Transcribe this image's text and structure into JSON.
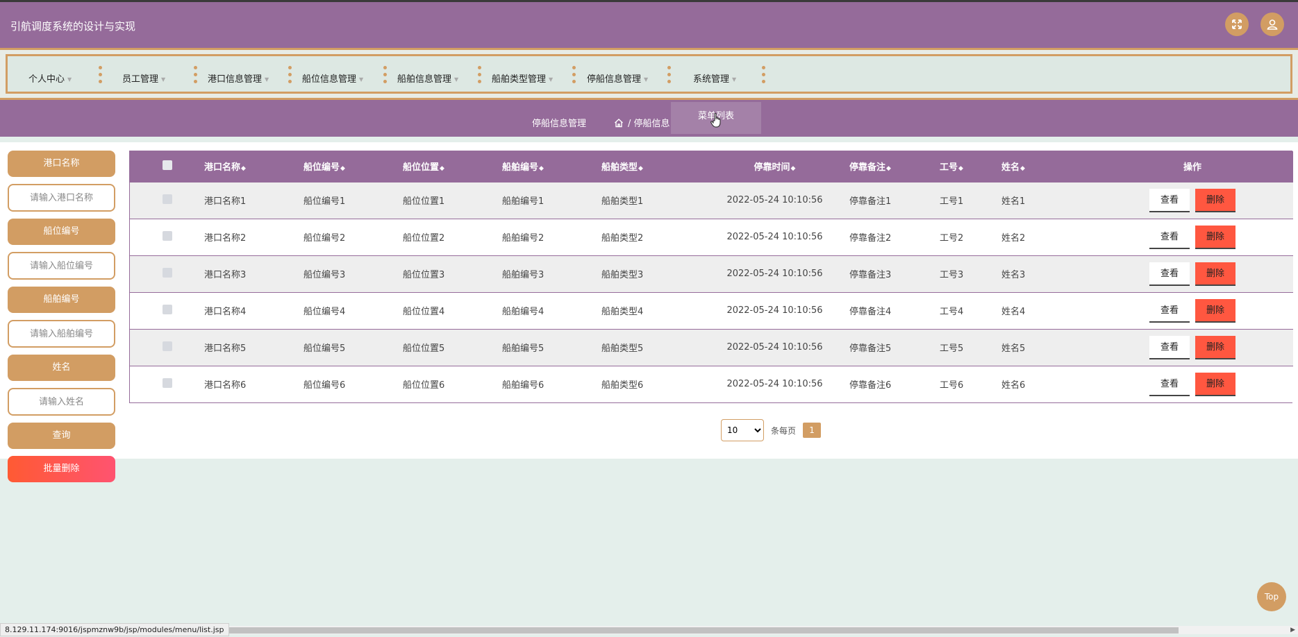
{
  "header": {
    "app_title": "引航调度系统的设计与实现",
    "fullscreen_icon": "expand-icon",
    "user_icon": "user-icon"
  },
  "nav": {
    "items": [
      {
        "label": "个人中心"
      },
      {
        "label": "员工管理"
      },
      {
        "label": "港口信息管理"
      },
      {
        "label": "船位信息管理"
      },
      {
        "label": "船舶信息管理"
      },
      {
        "label": "船舶类型管理"
      },
      {
        "label": "停船信息管理"
      },
      {
        "label": "系统管理"
      }
    ]
  },
  "breadcrumb": {
    "title": "停船信息管理",
    "path_visible": "/ 停船信息",
    "path_tail": "表",
    "tooltip": "菜单列表"
  },
  "sidebar": {
    "fields": [
      {
        "label": "港口名称",
        "placeholder": "请输入港口名称"
      },
      {
        "label": "船位编号",
        "placeholder": "请输入船位编号"
      },
      {
        "label": "船舶编号",
        "placeholder": "请输入船舶编号"
      },
      {
        "label": "姓名",
        "placeholder": "请输入姓名"
      }
    ],
    "query_label": "查询",
    "batch_delete_label": "批量删除"
  },
  "table": {
    "headers": [
      "港口名称",
      "船位编号",
      "船位位置",
      "船舶编号",
      "船舶类型",
      "停靠时间",
      "停靠备注",
      "工号",
      "姓名"
    ],
    "action_header": "操作",
    "sort_icon": "sort-icon",
    "view_label": "查看",
    "delete_label": "删除",
    "rows": [
      [
        "港口名称1",
        "船位编号1",
        "船位位置1",
        "船舶编号1",
        "船舶类型1",
        "2022-05-24 10:10:56",
        "停靠备注1",
        "工号1",
        "姓名1"
      ],
      [
        "港口名称2",
        "船位编号2",
        "船位位置2",
        "船舶编号2",
        "船舶类型2",
        "2022-05-24 10:10:56",
        "停靠备注2",
        "工号2",
        "姓名2"
      ],
      [
        "港口名称3",
        "船位编号3",
        "船位位置3",
        "船舶编号3",
        "船舶类型3",
        "2022-05-24 10:10:56",
        "停靠备注3",
        "工号3",
        "姓名3"
      ],
      [
        "港口名称4",
        "船位编号4",
        "船位位置4",
        "船舶编号4",
        "船舶类型4",
        "2022-05-24 10:10:56",
        "停靠备注4",
        "工号4",
        "姓名4"
      ],
      [
        "港口名称5",
        "船位编号5",
        "船位位置5",
        "船舶编号5",
        "船舶类型5",
        "2022-05-24 10:10:56",
        "停靠备注5",
        "工号5",
        "姓名5"
      ],
      [
        "港口名称6",
        "船位编号6",
        "船位位置6",
        "船舶编号6",
        "船舶类型6",
        "2022-05-24 10:10:56",
        "停靠备注6",
        "工号6",
        "姓名6"
      ]
    ]
  },
  "pager": {
    "page_size": "10",
    "per_page_label": "条每页",
    "current_page": "1"
  },
  "top_button_label": "Top",
  "status_url": "8.129.11.174:9016/jspmznw9b/jsp/modules/menu/list.jsp",
  "colors": {
    "primary": "#956b9a",
    "accent": "#d29d63",
    "danger": "#ff5740",
    "background": "#e4efeb"
  }
}
